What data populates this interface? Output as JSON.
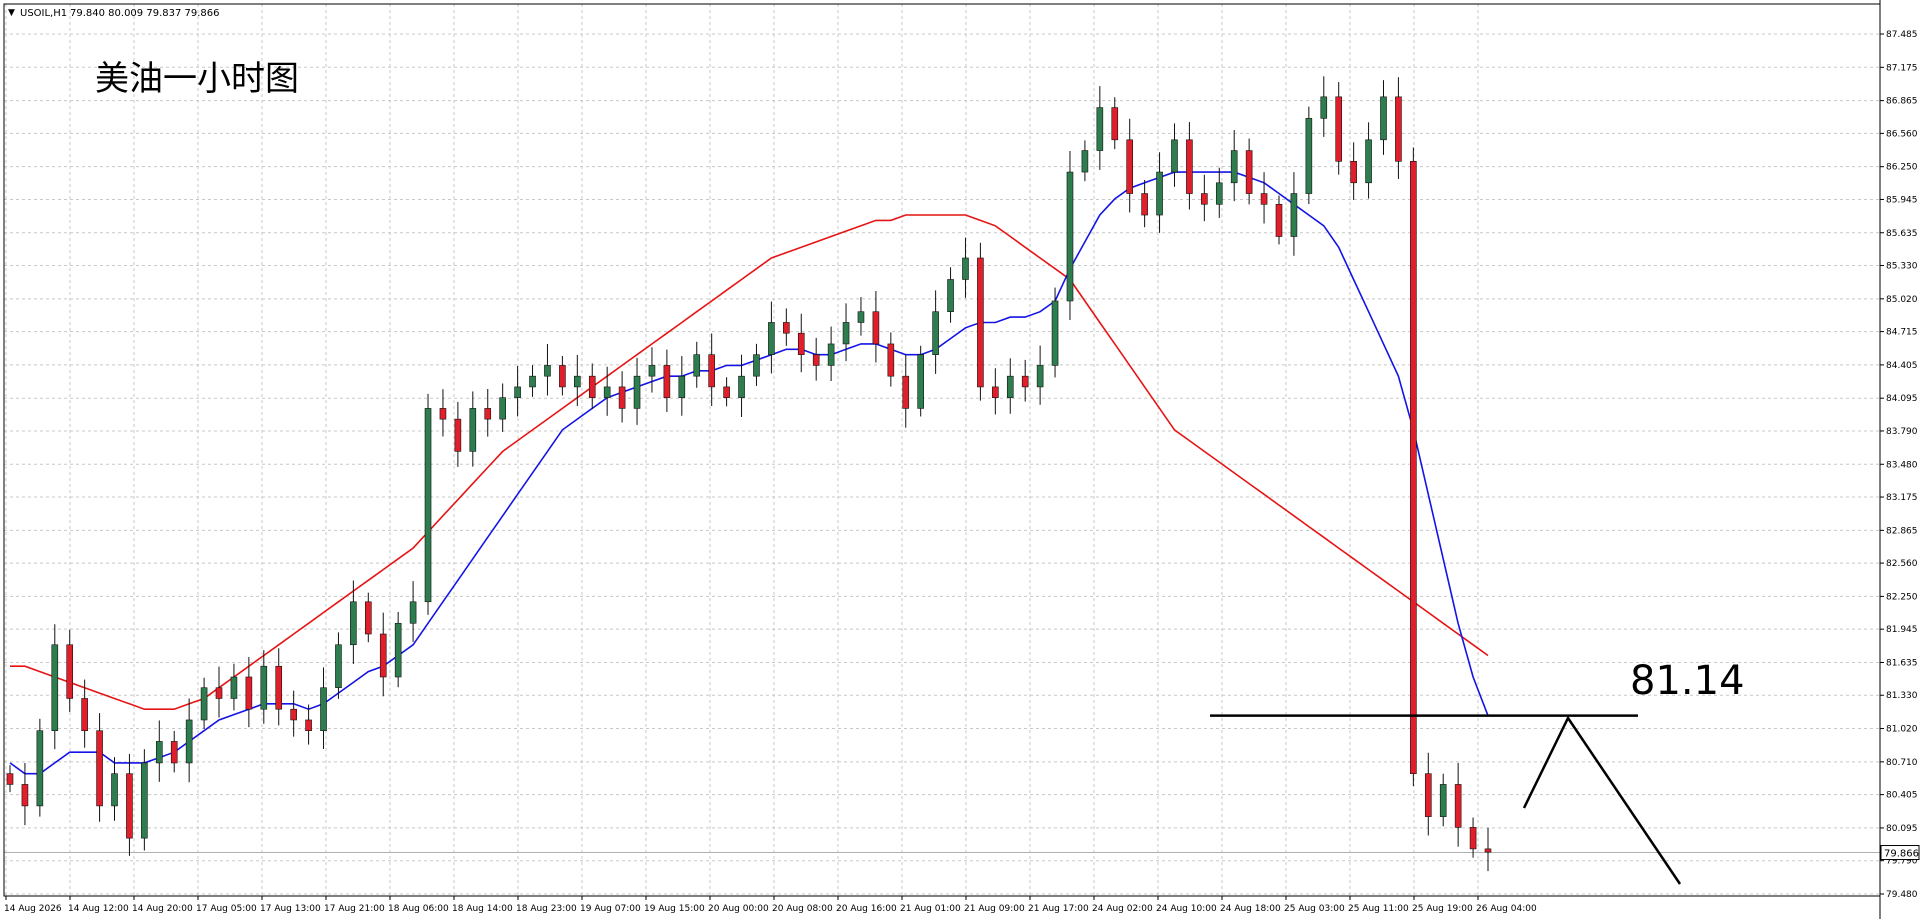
{
  "symbol_bar": {
    "menu_glyph": "▼",
    "symbol": "USOIL,H1",
    "ohlc": "79.840 80.009 79.837 79.866"
  },
  "annotation": {
    "chart_caption": "美油一小时图",
    "level_label": "81.14"
  },
  "colors": {
    "background": "#ffffff",
    "grid": "#c8c8c8",
    "bull_body": "#2e7d4f",
    "bear_body": "#e01f2a",
    "wick": "#111111",
    "ma_fast": "#1414e6",
    "ma_slow": "#e61414",
    "drawing": "#000000"
  },
  "chart_data": {
    "type": "candlestick",
    "title": "USOIL,H1",
    "x_tick_labels": [
      "14 Aug 2026",
      "14 Aug 12:00",
      "14 Aug 20:00",
      "17 Aug 05:00",
      "17 Aug 13:00",
      "17 Aug 21:00",
      "18 Aug 06:00",
      "18 Aug 14:00",
      "18 Aug 23:00",
      "19 Aug 07:00",
      "19 Aug 15:00",
      "20 Aug 00:00",
      "20 Aug 08:00",
      "20 Aug 16:00",
      "21 Aug 01:00",
      "21 Aug 09:00",
      "21 Aug 17:00",
      "24 Aug 02:00",
      "24 Aug 10:00",
      "24 Aug 18:00",
      "25 Aug 03:00",
      "25 Aug 11:00",
      "25 Aug 19:00",
      "26 Aug 04:00"
    ],
    "y_tick_labels": [
      "87.485",
      "87.175",
      "86.865",
      "86.560",
      "86.250",
      "85.945",
      "85.635",
      "85.330",
      "85.020",
      "84.715",
      "84.405",
      "84.095",
      "83.790",
      "83.480",
      "83.175",
      "82.865",
      "82.560",
      "82.250",
      "81.945",
      "81.635",
      "81.330",
      "81.020",
      "80.710",
      "80.405",
      "80.095",
      "79.790",
      "79.480"
    ],
    "ylim": [
      79.48,
      87.485
    ],
    "last_price": "79.866",
    "key_level": 81.14,
    "candle_count": 100,
    "close": [
      80.5,
      80.3,
      81.0,
      81.8,
      81.3,
      81.0,
      80.3,
      80.6,
      80.0,
      80.7,
      80.9,
      80.7,
      81.1,
      81.4,
      81.3,
      81.5,
      81.2,
      81.6,
      81.2,
      81.1,
      81.0,
      81.4,
      81.8,
      82.2,
      81.9,
      81.5,
      82.0,
      82.2,
      84.0,
      83.9,
      83.6,
      84.0,
      83.9,
      84.1,
      84.2,
      84.3,
      84.4,
      84.2,
      84.3,
      84.1,
      84.2,
      84.0,
      84.3,
      84.4,
      84.1,
      84.3,
      84.5,
      84.2,
      84.1,
      84.3,
      84.5,
      84.8,
      84.7,
      84.5,
      84.4,
      84.6,
      84.8,
      84.9,
      84.6,
      84.3,
      84.0,
      84.5,
      84.9,
      85.2,
      85.4,
      84.2,
      84.1,
      84.3,
      84.2,
      84.4,
      85.0,
      86.2,
      86.4,
      86.8,
      86.5,
      86.0,
      85.8,
      86.2,
      86.5,
      86.0,
      85.9,
      86.1,
      86.4,
      86.0,
      85.9,
      85.6,
      86.0,
      86.7,
      86.9,
      86.3,
      86.1,
      86.5,
      86.9,
      86.3,
      80.6,
      80.2,
      80.5,
      80.1,
      79.9,
      79.87
    ],
    "ma_fast": [
      80.7,
      80.6,
      80.6,
      80.7,
      80.8,
      80.8,
      80.8,
      80.7,
      80.7,
      80.7,
      80.75,
      80.8,
      80.9,
      81.0,
      81.1,
      81.15,
      81.2,
      81.25,
      81.25,
      81.25,
      81.2,
      81.25,
      81.35,
      81.45,
      81.55,
      81.6,
      81.7,
      81.8,
      82.0,
      82.2,
      82.4,
      82.6,
      82.8,
      83.0,
      83.2,
      83.4,
      83.6,
      83.8,
      83.9,
      84.0,
      84.1,
      84.15,
      84.2,
      84.25,
      84.3,
      84.3,
      84.35,
      84.35,
      84.4,
      84.4,
      84.45,
      84.5,
      84.55,
      84.55,
      84.5,
      84.5,
      84.55,
      84.6,
      84.6,
      84.55,
      84.5,
      84.5,
      84.55,
      84.65,
      84.75,
      84.8,
      84.8,
      84.85,
      84.85,
      84.9,
      85.0,
      85.3,
      85.55,
      85.8,
      85.95,
      86.05,
      86.1,
      86.15,
      86.2,
      86.2,
      86.2,
      86.2,
      86.2,
      86.15,
      86.1,
      86.0,
      85.9,
      85.8,
      85.7,
      85.5,
      85.2,
      84.9,
      84.6,
      84.3,
      83.8,
      83.2,
      82.6,
      82.0,
      81.5,
      81.14
    ],
    "ma_slow": [
      81.6,
      81.6,
      81.55,
      81.5,
      81.45,
      81.4,
      81.35,
      81.3,
      81.25,
      81.2,
      81.2,
      81.2,
      81.25,
      81.3,
      81.4,
      81.5,
      81.6,
      81.7,
      81.8,
      81.9,
      82.0,
      82.1,
      82.2,
      82.3,
      82.4,
      82.5,
      82.6,
      82.7,
      82.85,
      83.0,
      83.15,
      83.3,
      83.45,
      83.6,
      83.7,
      83.8,
      83.9,
      84.0,
      84.1,
      84.2,
      84.3,
      84.4,
      84.5,
      84.6,
      84.7,
      84.8,
      84.9,
      85.0,
      85.1,
      85.2,
      85.3,
      85.4,
      85.45,
      85.5,
      85.55,
      85.6,
      85.65,
      85.7,
      85.75,
      85.75,
      85.8,
      85.8,
      85.8,
      85.8,
      85.8,
      85.75,
      85.7,
      85.6,
      85.5,
      85.4,
      85.3,
      85.2,
      85.0,
      84.8,
      84.6,
      84.4,
      84.2,
      84.0,
      83.8,
      83.7,
      83.6,
      83.5,
      83.4,
      83.3,
      83.2,
      83.1,
      83.0,
      82.9,
      82.8,
      82.7,
      82.6,
      82.5,
      82.4,
      82.3,
      82.2,
      82.1,
      82.0,
      81.9,
      81.8,
      81.7
    ]
  }
}
